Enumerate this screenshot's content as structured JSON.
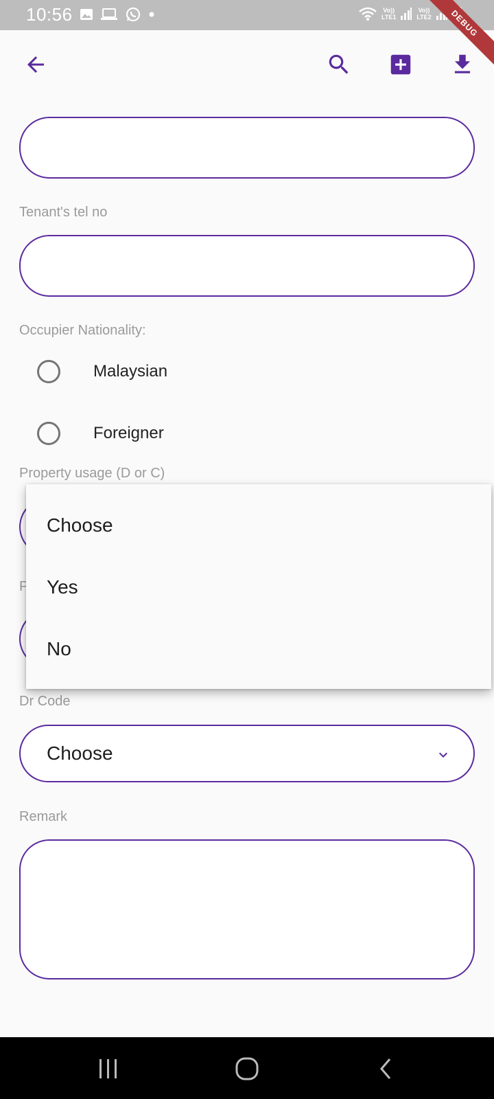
{
  "status_bar": {
    "time": "10:56",
    "sim1": {
      "top": "Vo))",
      "bottom": "LTE1"
    },
    "sim2": {
      "top": "Vo))",
      "bottom": "LTE2"
    }
  },
  "debug_banner": "DEBUG",
  "app_bar": {
    "icons": [
      "back-arrow-icon",
      "search-icon",
      "add-box-icon",
      "download-icon"
    ],
    "accent": "#5b2a9e"
  },
  "form": {
    "tenant_tel_label": "Tenant's tel no",
    "occupier_nationality_label": "Occupier Nationality:",
    "nationality_options": [
      "Malaysian",
      "Foreigner"
    ],
    "property_usage_label": "Property usage (D or C)",
    "hidden_label_initial": "P",
    "dr_code_label": "Dr Code",
    "dr_code_value": "Choose",
    "remark_label": "Remark"
  },
  "dropdown_menu": {
    "items": [
      "Choose",
      "Yes",
      "No"
    ]
  },
  "colors": {
    "accent": "#5b2a9e",
    "label": "#9a9a9a",
    "status_bar": "#bdbdbd",
    "debug": "#b0383a"
  }
}
